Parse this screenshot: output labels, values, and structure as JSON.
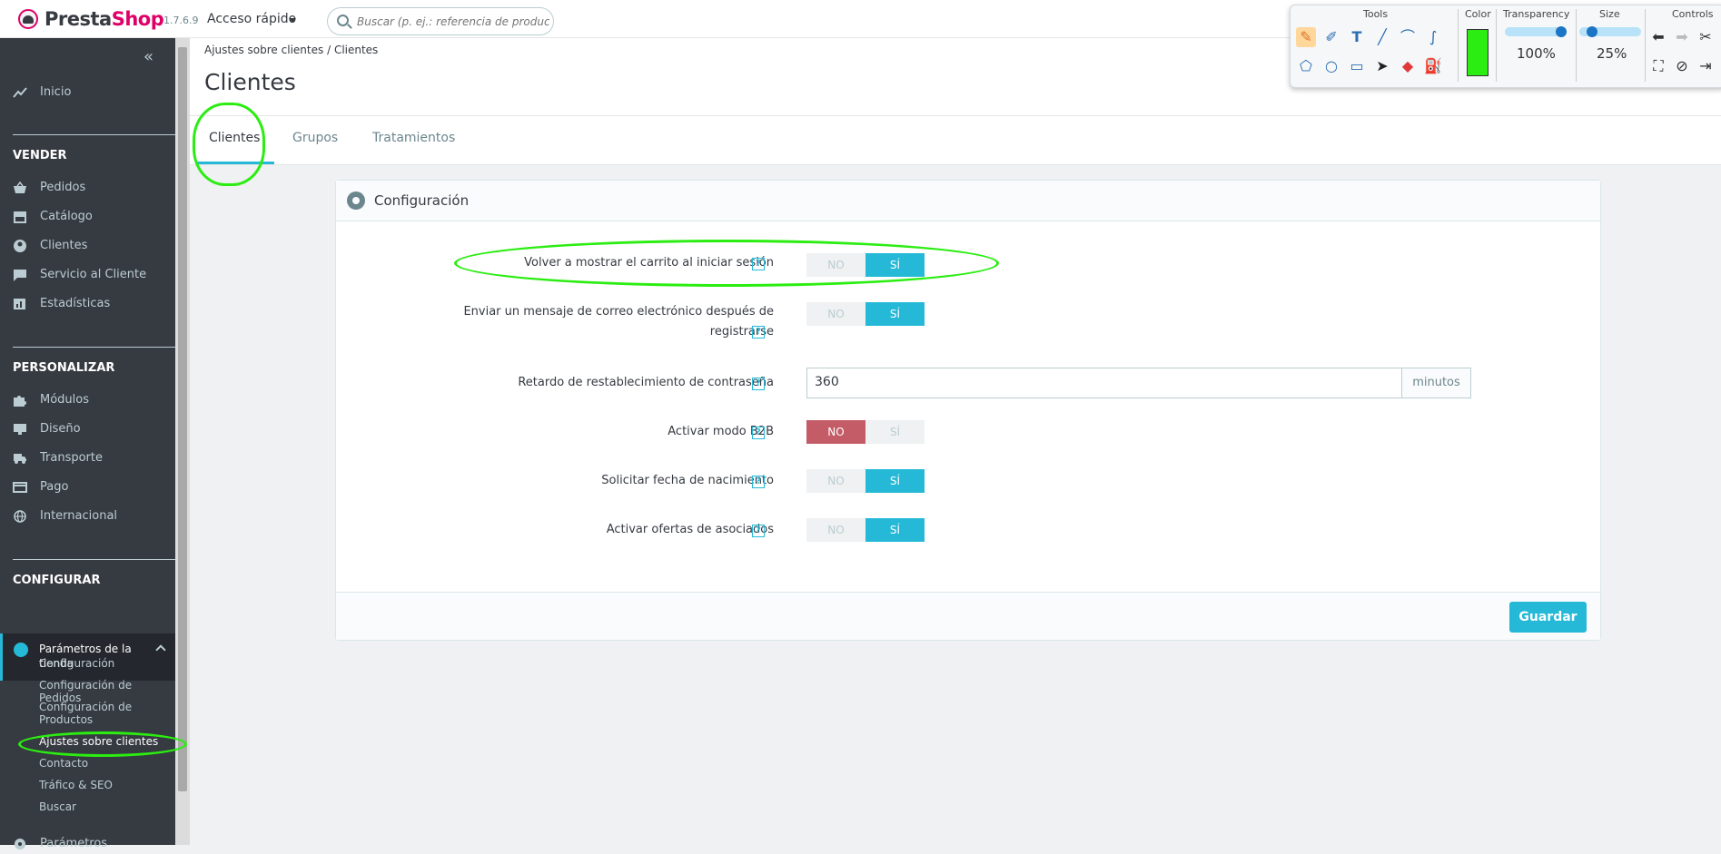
{
  "topbar": {
    "logo_text_presta": "Presta",
    "logo_text_shop": "Shop",
    "version": "1.7.6.9",
    "quick_access": "Acceso rápido",
    "search_placeholder": "Buscar (p. ej.: referencia de producto, nombre de cliente...)"
  },
  "sidebar": {
    "collapse_icon": "«",
    "home": "Inicio",
    "sections": [
      {
        "title": "VENDER",
        "items": [
          "Pedidos",
          "Catálogo",
          "Clientes",
          "Servicio al Cliente",
          "Estadísticas"
        ]
      },
      {
        "title": "PERSONALIZAR",
        "items": [
          "Módulos",
          "Diseño",
          "Transporte",
          "Pago",
          "Internacional"
        ]
      },
      {
        "title": "CONFIGURAR",
        "active_item_line1": "Parámetros de la",
        "active_item_line2": "tienda",
        "sub_items": [
          "Configuración",
          "Configuración de Pedidos",
          "Configuración de",
          "Productos",
          "Ajustes sobre clientes",
          "Contacto",
          "Tráfico & SEO",
          "Buscar"
        ],
        "next_item": "Parámetros"
      }
    ],
    "icons": [
      "chart-line-icon",
      "basket-icon",
      "store-icon",
      "user-circle-icon",
      "chat-icon",
      "bar-chart-icon",
      "puzzle-icon",
      "monitor-icon",
      "truck-icon",
      "card-icon",
      "globe-icon",
      "gear-icon"
    ]
  },
  "breadcrumb": {
    "parent": "Ajustes sobre clientes",
    "separator": "/",
    "current": "Clientes"
  },
  "page_title": "Clientes",
  "tabs": [
    {
      "label": "Clientes",
      "active": true
    },
    {
      "label": "Grupos",
      "active": false
    },
    {
      "label": "Tratamientos",
      "active": false
    }
  ],
  "panel": {
    "title": "Configuración",
    "fields": [
      {
        "label": "Volver a mostrar el carrito al iniciar sesión",
        "no": "NO",
        "yes": "SÍ",
        "value": "yes"
      },
      {
        "label_line1": "Enviar un mensaje de correo electrónico después de",
        "label_line2": "registrarse",
        "no": "NO",
        "yes": "SÍ",
        "value": "yes"
      },
      {
        "label": "Retardo de restablecimiento de contraseña",
        "input_value": "360",
        "addon": "minutos"
      },
      {
        "label": "Activar modo B2B",
        "no": "NO",
        "yes": "SÍ",
        "value": "no"
      },
      {
        "label": "Solicitar fecha de nacimiento",
        "no": "NO",
        "yes": "SÍ",
        "value": "yes"
      },
      {
        "label": "Activar ofertas de asociados",
        "no": "NO",
        "yes": "SÍ",
        "value": "yes"
      }
    ],
    "help_glyph": "?",
    "save_label": "Guardar"
  },
  "annotation_toolbox": {
    "tools_label": "Tools",
    "color_label": "Color",
    "transparency_label": "Transparency",
    "size_label": "Size",
    "controls_label": "Controls",
    "transparency_value": "100%",
    "size_value": "25%",
    "transparency_level": 1.0,
    "size_level": 0.25,
    "selected_color": "#2bed11",
    "tool_icons": [
      "pencil-icon",
      "marker-icon",
      "text-icon",
      "line-icon",
      "curve-icon",
      "freehand-icon",
      "polygon-icon",
      "circle-icon",
      "rectangle-icon",
      "pointer-icon",
      "eraser-icon",
      "fill-icon"
    ],
    "control_icons": [
      "undo-icon",
      "redo-icon",
      "clear-icon",
      "screenshot-icon",
      "hide-icon",
      "exit-icon"
    ]
  },
  "colors": {
    "accent": "#25b9d7",
    "sidebar_bg": "#363a41",
    "danger": "#c45c67",
    "highlight": "#2bed11"
  }
}
